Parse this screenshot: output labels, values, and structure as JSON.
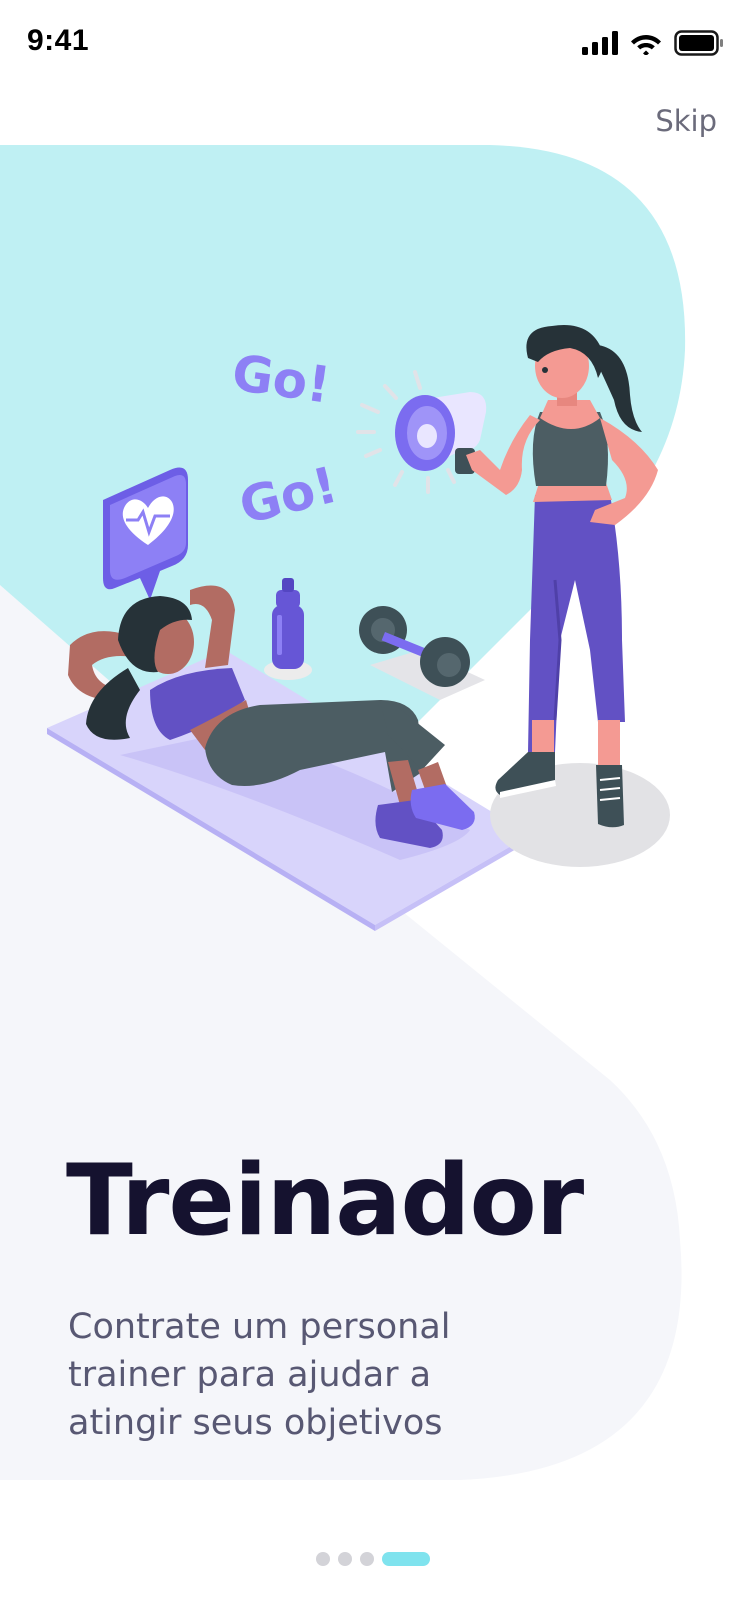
{
  "status_bar": {
    "time": "9:41"
  },
  "skip_label": "Skip",
  "illustration": {
    "go_text_1": "Go!",
    "go_text_2": "Go!"
  },
  "onboarding": {
    "title": "Treinador",
    "description": "Contrate um personal trainer para ajudar a atingir seus objetivos"
  },
  "pager": {
    "total": 4,
    "active_index": 3
  },
  "colors": {
    "cyan_blob": "#bff0f3",
    "gray_blob": "#f5f6fa",
    "purple": "#7b6cf0",
    "title": "#15122f",
    "subtitle": "#585873",
    "dot_inactive": "#d3d3d8",
    "dot_active": "#7fe3ee"
  }
}
